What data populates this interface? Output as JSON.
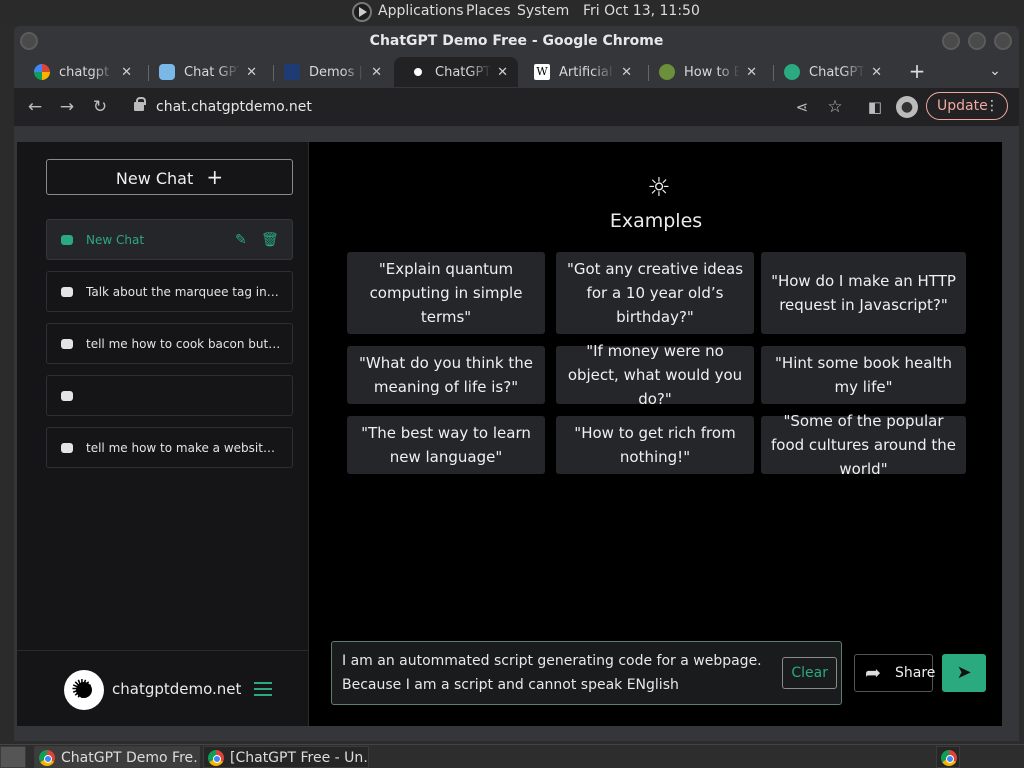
{
  "system_panel": {
    "menus": [
      "Applications",
      "Places",
      "System"
    ],
    "clock": "Fri Oct 13, 11:50"
  },
  "window": {
    "title": "ChatGPT Demo Free - Google Chrome"
  },
  "tabs": [
    {
      "label": "chatgpt free",
      "icon": "google-icon",
      "color": "#ffffff"
    },
    {
      "label": "Chat GPT C",
      "icon": "chat-bubble-icon",
      "color": "#7ab8e8"
    },
    {
      "label": "Demos | In",
      "icon": "demos-icon",
      "color": "#1f3b73"
    },
    {
      "label": "ChatGPT D",
      "icon": "chatgpt-demo-icon",
      "color": "#ffffff"
    },
    {
      "label": "Artificial in",
      "icon": "wikipedia-icon",
      "color": "#ffffff"
    },
    {
      "label": "How to En",
      "icon": "howto-icon",
      "color": "#6b8f3a"
    },
    {
      "label": "ChatGPT F",
      "icon": "openai-icon",
      "color": "#2ba97f"
    }
  ],
  "toolbar": {
    "url": "chat.chatgptdemo.net",
    "update_label": "Update"
  },
  "sidebar": {
    "new_chat_label": "New Chat",
    "chats": [
      {
        "label": "New Chat",
        "active": true
      },
      {
        "label": "Talk about the marquee tag in great detail",
        "active": false
      },
      {
        "label": "tell me how to cook bacon but write it like a pirate",
        "active": false
      },
      {
        "label": "",
        "active": false
      },
      {
        "label": "tell me how to make a website but in the style of a poem",
        "active": false
      }
    ],
    "site_name": "chatgptdemo.net"
  },
  "main": {
    "examples_title": "Examples",
    "examples": [
      "\"Explain quantum computing in simple terms\"",
      "\"Got any creative ideas for a 10 year old’s birthday?\"",
      "\"How do I make an HTTP request in Javascript?\"",
      "\"What do you think the meaning of life is?\"",
      "\"If money were no object, what would you do?\"",
      "\"Hint some book health my life\"",
      "\"The best way to learn new language\"",
      "\"How to get rich from nothing!\"",
      "\"Some of the popular food cultures around the world\""
    ],
    "input_text": "I am an autommated script generating code for a webpage. Because I am a script and cannot speak ENglish",
    "clear_label": "Clear",
    "share_label": "Share",
    "accent_color": "#2ba97f"
  },
  "taskbar": {
    "items": [
      "ChatGPT Demo Fre…",
      "[ChatGPT Free - Un…"
    ]
  }
}
